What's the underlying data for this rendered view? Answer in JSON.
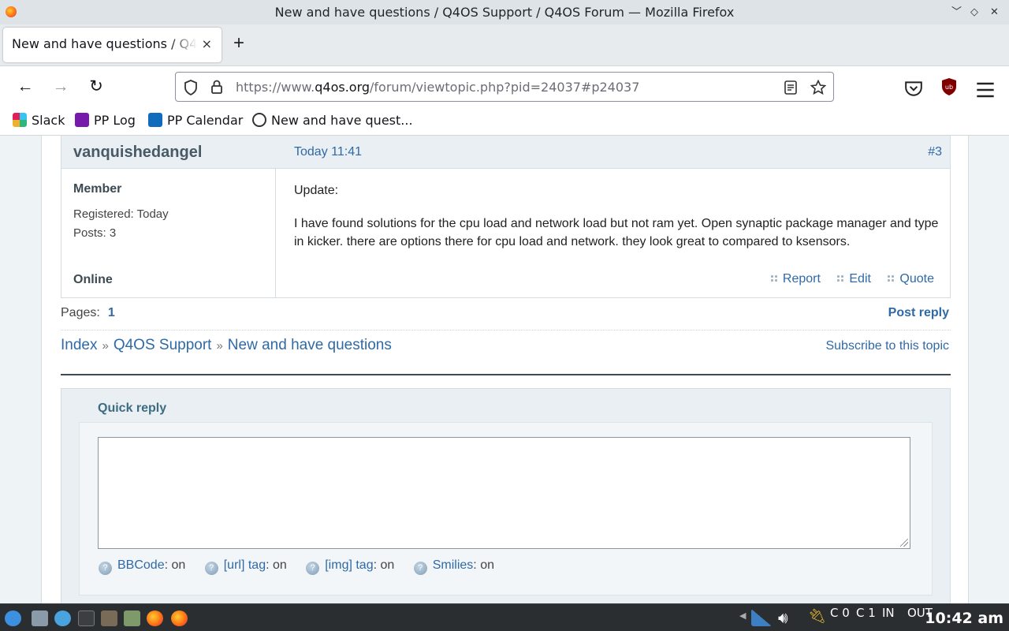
{
  "window": {
    "title": "New and have questions / Q4OS Support / Q4OS Forum — Mozilla Firefox",
    "controls": [
      "﹀",
      "◇",
      "✕"
    ]
  },
  "tab": {
    "title": "New and have questions / Q4OS Support / Q4OS Forum",
    "close": "×",
    "new_tab": "+"
  },
  "nav": {
    "back": "←",
    "forward": "→",
    "reload": "↻",
    "url_prefix": "https://www.",
    "url_domain": "q4os.org",
    "url_path": "/forum/viewtopic.php?pid=24037#p24037"
  },
  "bookmarks": [
    {
      "label": "Slack",
      "color": "#e01e5a"
    },
    {
      "label": "PP Log",
      "color": "#7719aa"
    },
    {
      "label": "PP Calendar",
      "color": "#0f6cbd"
    },
    {
      "label": "New and have quest...",
      "color": "#333333"
    }
  ],
  "post": {
    "author": "vanquishedangel",
    "time": "Today 11:41",
    "number": "#3",
    "role": "Member",
    "registered": "Registered: Today",
    "posts": "Posts: 3",
    "status": "Online",
    "body_line1": "Update:",
    "body_line2": "I have found solutions for the cpu load and network load but not ram yet. Open synaptic package manager and type in kicker. there are options there for cpu load and network. they look great to compared to ksensors.",
    "actions": {
      "report": "Report",
      "edit": "Edit",
      "quote": "Quote"
    }
  },
  "pagination": {
    "label": "Pages:",
    "current": "1",
    "post_reply": "Post reply"
  },
  "breadcrumb": {
    "index": "Index",
    "forum": "Q4OS Support",
    "topic": "New and have questions",
    "sep": "»"
  },
  "subscribe": "Subscribe to this topic",
  "quick_reply": {
    "title": "Quick reply",
    "options": [
      {
        "name": "BBCode",
        "state": ": on"
      },
      {
        "name": "[url] tag",
        "state": ": on"
      },
      {
        "name": "[img] tag",
        "state": ": on"
      },
      {
        "name": "Smilies",
        "state": ": on"
      }
    ]
  },
  "taskbar": {
    "cpu0": "C 0",
    "cpu1": "C 1",
    "net_in": "IN",
    "net_out": "OUT",
    "clock": "10:42 am"
  },
  "colors": {
    "link": "#2f6aa6",
    "header_bg": "#e9eff3",
    "taskbar": "#2b2e31"
  }
}
